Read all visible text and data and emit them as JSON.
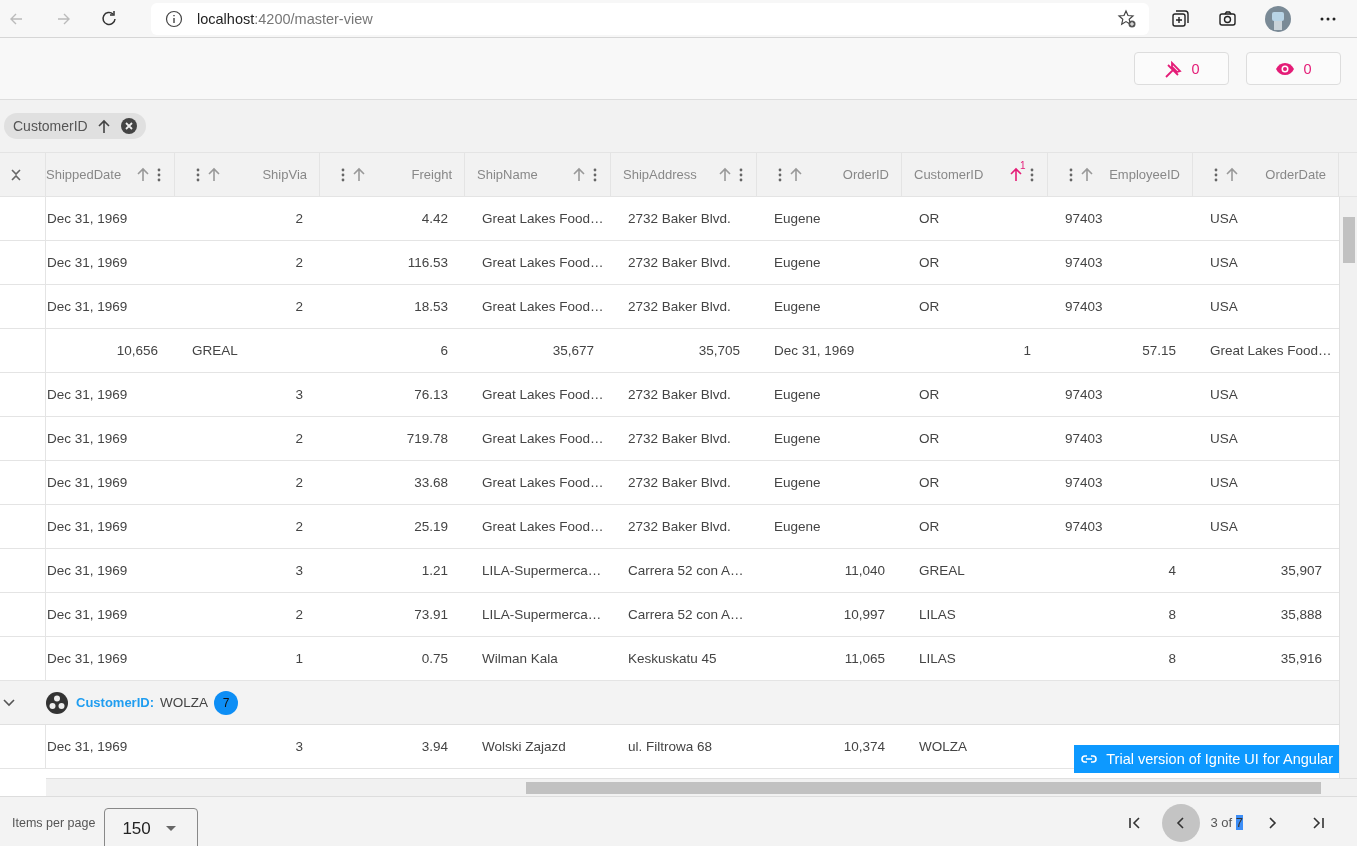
{
  "browser": {
    "url_host": "localhost",
    "url_rest": ":4200/master-view"
  },
  "toolbar": {
    "buttons": [
      {
        "kind": "pinned",
        "count": "0"
      },
      {
        "kind": "hidden",
        "count": "0"
      }
    ]
  },
  "group_by": {
    "chips": [
      {
        "label": "CustomerID"
      }
    ]
  },
  "grid": {
    "columns": [
      {
        "label": "ShippedDate",
        "kind": "text",
        "sorted": false
      },
      {
        "label": "ShipVia",
        "kind": "number",
        "sorted": false
      },
      {
        "label": "Freight",
        "kind": "number",
        "sorted": false
      },
      {
        "label": "ShipName",
        "kind": "text",
        "sorted": false
      },
      {
        "label": "ShipAddress",
        "kind": "text",
        "sorted": false
      },
      {
        "label": "OrderID",
        "kind": "number",
        "sorted": false
      },
      {
        "label": "CustomerID",
        "kind": "text",
        "sorted": true,
        "sort_index": "1"
      },
      {
        "label": "EmployeeID",
        "kind": "number",
        "sorted": false
      },
      {
        "label": "OrderDate",
        "kind": "number",
        "sorted": false
      }
    ],
    "rows": [
      {
        "kind": "data",
        "cells": [
          {
            "text": "Dec 31, 1969",
            "kind": "text"
          },
          {
            "text": "2",
            "kind": "number"
          },
          {
            "text": "4.42",
            "kind": "number"
          },
          {
            "text": "Great Lakes Food…",
            "kind": "text"
          },
          {
            "text": "2732 Baker Blvd.",
            "kind": "text"
          },
          {
            "text": "Eugene",
            "kind": "text"
          },
          {
            "text": "OR",
            "kind": "text"
          },
          {
            "text": "97403",
            "kind": "text"
          },
          {
            "text": "USA",
            "kind": "text"
          }
        ]
      },
      {
        "kind": "data",
        "cells": [
          {
            "text": "Dec 31, 1969",
            "kind": "text"
          },
          {
            "text": "2",
            "kind": "number"
          },
          {
            "text": "116.53",
            "kind": "number"
          },
          {
            "text": "Great Lakes Food…",
            "kind": "text"
          },
          {
            "text": "2732 Baker Blvd.",
            "kind": "text"
          },
          {
            "text": "Eugene",
            "kind": "text"
          },
          {
            "text": "OR",
            "kind": "text"
          },
          {
            "text": "97403",
            "kind": "text"
          },
          {
            "text": "USA",
            "kind": "text"
          }
        ]
      },
      {
        "kind": "data",
        "cells": [
          {
            "text": "Dec 31, 1969",
            "kind": "text"
          },
          {
            "text": "2",
            "kind": "number"
          },
          {
            "text": "18.53",
            "kind": "number"
          },
          {
            "text": "Great Lakes Food…",
            "kind": "text"
          },
          {
            "text": "2732 Baker Blvd.",
            "kind": "text"
          },
          {
            "text": "Eugene",
            "kind": "text"
          },
          {
            "text": "OR",
            "kind": "text"
          },
          {
            "text": "97403",
            "kind": "text"
          },
          {
            "text": "USA",
            "kind": "text"
          }
        ]
      },
      {
        "kind": "data",
        "cells": [
          {
            "text": "10,656",
            "kind": "number"
          },
          {
            "text": "GREAL",
            "kind": "text"
          },
          {
            "text": "6",
            "kind": "number"
          },
          {
            "text": "35,677",
            "kind": "number"
          },
          {
            "text": "35,705",
            "kind": "number"
          },
          {
            "text": "Dec 31, 1969",
            "kind": "text"
          },
          {
            "text": "1",
            "kind": "number"
          },
          {
            "text": "57.15",
            "kind": "number"
          },
          {
            "text": "Great Lakes Food…",
            "kind": "text"
          }
        ]
      },
      {
        "kind": "data",
        "cells": [
          {
            "text": "Dec 31, 1969",
            "kind": "text"
          },
          {
            "text": "3",
            "kind": "number"
          },
          {
            "text": "76.13",
            "kind": "number"
          },
          {
            "text": "Great Lakes Food…",
            "kind": "text"
          },
          {
            "text": "2732 Baker Blvd.",
            "kind": "text"
          },
          {
            "text": "Eugene",
            "kind": "text"
          },
          {
            "text": "OR",
            "kind": "text"
          },
          {
            "text": "97403",
            "kind": "text"
          },
          {
            "text": "USA",
            "kind": "text"
          }
        ]
      },
      {
        "kind": "data",
        "cells": [
          {
            "text": "Dec 31, 1969",
            "kind": "text"
          },
          {
            "text": "2",
            "kind": "number"
          },
          {
            "text": "719.78",
            "kind": "number"
          },
          {
            "text": "Great Lakes Food…",
            "kind": "text"
          },
          {
            "text": "2732 Baker Blvd.",
            "kind": "text"
          },
          {
            "text": "Eugene",
            "kind": "text"
          },
          {
            "text": "OR",
            "kind": "text"
          },
          {
            "text": "97403",
            "kind": "text"
          },
          {
            "text": "USA",
            "kind": "text"
          }
        ]
      },
      {
        "kind": "data",
        "cells": [
          {
            "text": "Dec 31, 1969",
            "kind": "text"
          },
          {
            "text": "2",
            "kind": "number"
          },
          {
            "text": "33.68",
            "kind": "number"
          },
          {
            "text": "Great Lakes Food…",
            "kind": "text"
          },
          {
            "text": "2732 Baker Blvd.",
            "kind": "text"
          },
          {
            "text": "Eugene",
            "kind": "text"
          },
          {
            "text": "OR",
            "kind": "text"
          },
          {
            "text": "97403",
            "kind": "text"
          },
          {
            "text": "USA",
            "kind": "text"
          }
        ]
      },
      {
        "kind": "data",
        "cells": [
          {
            "text": "Dec 31, 1969",
            "kind": "text"
          },
          {
            "text": "2",
            "kind": "number"
          },
          {
            "text": "25.19",
            "kind": "number"
          },
          {
            "text": "Great Lakes Food…",
            "kind": "text"
          },
          {
            "text": "2732 Baker Blvd.",
            "kind": "text"
          },
          {
            "text": "Eugene",
            "kind": "text"
          },
          {
            "text": "OR",
            "kind": "text"
          },
          {
            "text": "97403",
            "kind": "text"
          },
          {
            "text": "USA",
            "kind": "text"
          }
        ]
      },
      {
        "kind": "data",
        "cells": [
          {
            "text": "Dec 31, 1969",
            "kind": "text"
          },
          {
            "text": "3",
            "kind": "number"
          },
          {
            "text": "1.21",
            "kind": "number"
          },
          {
            "text": "LILA-Supermerca…",
            "kind": "text"
          },
          {
            "text": "Carrera 52 con A…",
            "kind": "text"
          },
          {
            "text": "11,040",
            "kind": "number"
          },
          {
            "text": "GREAL",
            "kind": "text"
          },
          {
            "text": "4",
            "kind": "number"
          },
          {
            "text": "35,907",
            "kind": "number"
          }
        ]
      },
      {
        "kind": "data",
        "cells": [
          {
            "text": "Dec 31, 1969",
            "kind": "text"
          },
          {
            "text": "2",
            "kind": "number"
          },
          {
            "text": "73.91",
            "kind": "number"
          },
          {
            "text": "LILA-Supermerca…",
            "kind": "text"
          },
          {
            "text": "Carrera 52 con A…",
            "kind": "text"
          },
          {
            "text": "10,997",
            "kind": "number"
          },
          {
            "text": "LILAS",
            "kind": "text"
          },
          {
            "text": "8",
            "kind": "number"
          },
          {
            "text": "35,888",
            "kind": "number"
          }
        ]
      },
      {
        "kind": "data",
        "cells": [
          {
            "text": "Dec 31, 1969",
            "kind": "text"
          },
          {
            "text": "1",
            "kind": "number"
          },
          {
            "text": "0.75",
            "kind": "number"
          },
          {
            "text": "Wilman Kala",
            "kind": "text"
          },
          {
            "text": "Keskuskatu 45",
            "kind": "text"
          },
          {
            "text": "11,065",
            "kind": "number"
          },
          {
            "text": "LILAS",
            "kind": "text"
          },
          {
            "text": "8",
            "kind": "number"
          },
          {
            "text": "35,916",
            "kind": "number"
          }
        ]
      },
      {
        "kind": "group",
        "expanded": true,
        "field": "CustomerID:",
        "value": "WOLZA",
        "count": "7"
      },
      {
        "kind": "data",
        "cells": [
          {
            "text": "Dec 31, 1969",
            "kind": "text"
          },
          {
            "text": "3",
            "kind": "number"
          },
          {
            "text": "3.94",
            "kind": "number"
          },
          {
            "text": "Wolski Zajazd",
            "kind": "text"
          },
          {
            "text": "ul. Filtrowa 68",
            "kind": "text"
          },
          {
            "text": "10,374",
            "kind": "number"
          },
          {
            "text": "WOLZA",
            "kind": "text"
          }
        ]
      }
    ]
  },
  "trial_badge": {
    "text": "Trial version of Ignite UI for Angular"
  },
  "paginator": {
    "label": "Items per page",
    "per_page": "150",
    "page_text": "3 of",
    "total": "7",
    "total_highlighted": true,
    "prev_focused": true
  }
}
